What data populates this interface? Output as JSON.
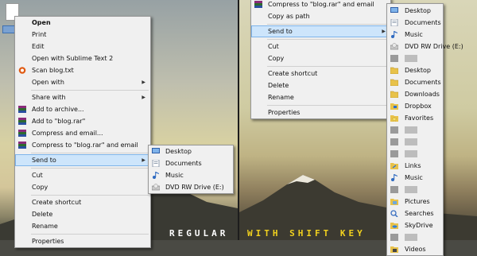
{
  "left_menu": {
    "items": [
      {
        "label": "Open",
        "bold": true,
        "icon": "none"
      },
      {
        "label": "Print",
        "icon": "none"
      },
      {
        "label": "Edit",
        "icon": "none"
      },
      {
        "label": "Open with Sublime Text 2",
        "icon": "none"
      },
      {
        "label": "Scan blog.txt",
        "icon": "antivirus-icon"
      },
      {
        "label": "Open with",
        "icon": "none",
        "submenu": true,
        "sep": true
      },
      {
        "label": "Share with",
        "icon": "none",
        "submenu": true
      },
      {
        "label": "Add to archive...",
        "icon": "winrar-icon"
      },
      {
        "label": "Add to \"blog.rar\"",
        "icon": "winrar-icon"
      },
      {
        "label": "Compress and email...",
        "icon": "winrar-icon"
      },
      {
        "label": "Compress to \"blog.rar\" and email",
        "icon": "winrar-icon",
        "sep": true
      },
      {
        "label": "Send to",
        "icon": "none",
        "submenu": true,
        "highlight": true,
        "sep": true
      },
      {
        "label": "Cut",
        "icon": "none"
      },
      {
        "label": "Copy",
        "icon": "none",
        "sep": true
      },
      {
        "label": "Create shortcut",
        "icon": "none"
      },
      {
        "label": "Delete",
        "icon": "none"
      },
      {
        "label": "Rename",
        "icon": "none",
        "sep": true
      },
      {
        "label": "Properties",
        "icon": "none"
      }
    ]
  },
  "left_sendto": {
    "items": [
      {
        "label": "Desktop",
        "icon": "desktop-icon"
      },
      {
        "label": "Documents",
        "icon": "documents-icon"
      },
      {
        "label": "Music",
        "icon": "music-icon"
      },
      {
        "label": "DVD RW Drive (E:)",
        "icon": "dvd-drive-icon"
      }
    ]
  },
  "right_menu": {
    "items": [
      {
        "label": "Compress to \"blog.rar\" and email",
        "icon": "winrar-icon"
      },
      {
        "label": "Copy as path",
        "icon": "none",
        "sep": true
      },
      {
        "label": "Send to",
        "icon": "none",
        "submenu": true,
        "highlight": true,
        "sep": true
      },
      {
        "label": "Cut",
        "icon": "none"
      },
      {
        "label": "Copy",
        "icon": "none",
        "sep": true
      },
      {
        "label": "Create shortcut",
        "icon": "none"
      },
      {
        "label": "Delete",
        "icon": "none"
      },
      {
        "label": "Rename",
        "icon": "none",
        "sep": true
      },
      {
        "label": "Properties",
        "icon": "none"
      }
    ]
  },
  "right_sendto": {
    "items": [
      {
        "label": "Desktop",
        "icon": "desktop-icon"
      },
      {
        "label": "Documents",
        "icon": "documents-icon"
      },
      {
        "label": "Music",
        "icon": "music-icon"
      },
      {
        "label": "DVD RW Drive (E:)",
        "icon": "dvd-drive-icon"
      },
      {
        "label": "",
        "icon": "blurred-item-icon"
      },
      {
        "label": "Desktop",
        "icon": "folder-icon"
      },
      {
        "label": "Documents",
        "icon": "folder-icon"
      },
      {
        "label": "Downloads",
        "icon": "folder-icon"
      },
      {
        "label": "Dropbox",
        "icon": "dropbox-icon"
      },
      {
        "label": "Favorites",
        "icon": "favorites-icon"
      },
      {
        "label": "",
        "icon": "blurred-item-icon"
      },
      {
        "label": "",
        "icon": "blurred-item-icon"
      },
      {
        "label": "",
        "icon": "blurred-item-icon"
      },
      {
        "label": "Links",
        "icon": "links-icon"
      },
      {
        "label": "Music",
        "icon": "music-icon"
      },
      {
        "label": "",
        "icon": "blurred-item-icon"
      },
      {
        "label": "Pictures",
        "icon": "pictures-icon"
      },
      {
        "label": "Searches",
        "icon": "search-icon"
      },
      {
        "label": "SkyDrive",
        "icon": "skydrive-icon"
      },
      {
        "label": "",
        "icon": "blurred-item-icon"
      },
      {
        "label": "Videos",
        "icon": "videos-icon"
      }
    ]
  },
  "captions": {
    "left": "REGULAR",
    "right": "WITH SHIFT KEY"
  },
  "colors": {
    "highlight": "#cde5fb",
    "caption_right": "#f2d21e",
    "caption_left": "#ffffff"
  }
}
